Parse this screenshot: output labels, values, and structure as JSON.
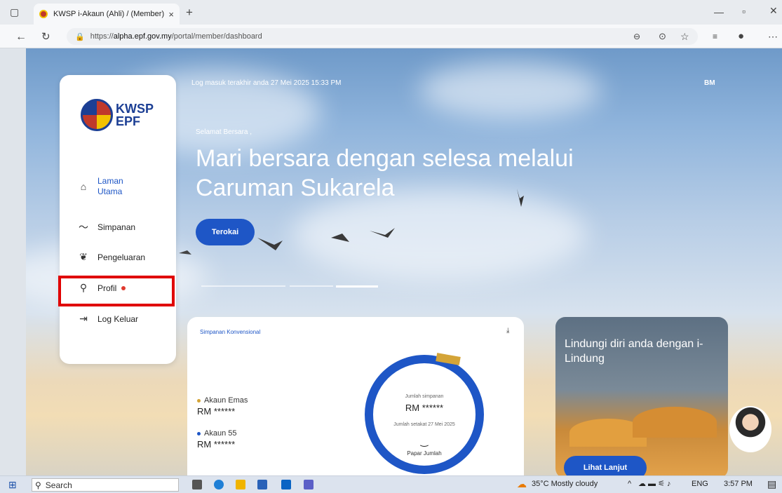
{
  "browser": {
    "tab_title": "KWSP i-Akaun (Ahli) / (Member) |",
    "tab_close": "×",
    "new_tab": "+",
    "url_prefix": "https://",
    "url_domain": "alpha.epf.gov.my",
    "url_path": "/portal/member/dashboard",
    "nav_icons": [
      "back-icon",
      "refresh-icon",
      "lock-icon"
    ],
    "window_controls": [
      "minimize-icon",
      "restore-icon",
      "close-icon"
    ]
  },
  "sidebar": {
    "logo_line1": "KWSP",
    "logo_line2": "EPF",
    "items": [
      {
        "label": "Laman Utama",
        "icon": "home-icon"
      },
      {
        "label": "Simpanan",
        "icon": "trend-icon"
      },
      {
        "label": "Pengeluaran",
        "icon": "leaf-icon"
      },
      {
        "label": "Profil",
        "icon": "user-icon",
        "alert": true
      },
      {
        "label": "Log Keluar",
        "icon": "logout-icon"
      }
    ]
  },
  "header": {
    "last_login": "Log masuk terakhir anda 27 Mei 2025 15:33 PM",
    "language": "BM"
  },
  "hero": {
    "greeting": "Selamat Bersara ,",
    "title": "Mari bersara dengan selesa melalui Caruman Sukarela",
    "cta": "Terokai"
  },
  "savings_card": {
    "title": "Simpanan Konvensional",
    "accounts": [
      {
        "name": "Akaun Emas",
        "amount": "RM ******",
        "color": "#d4a437"
      },
      {
        "name": "Akaun 55",
        "amount": "RM ******",
        "color": "#1e56c6"
      }
    ],
    "total_label": "Jumlah simpanan",
    "total_amount": "RM ******",
    "as_of": "Jumlah setakat 27 Mei 2025",
    "show_total": "Papar Jumlah"
  },
  "promo": {
    "title": "Lindungi diri anda dengan i-Lindung",
    "cta": "Lihat Lanjut"
  },
  "taskbar": {
    "search_placeholder": "Search",
    "weather": "35°C Mostly cloudy",
    "language": "ENG",
    "time": "3:57 PM"
  },
  "colors": {
    "primary": "#1e56c6",
    "gold": "#d4a437",
    "highlight": "#e00000",
    "alert": "#e03a2f"
  }
}
